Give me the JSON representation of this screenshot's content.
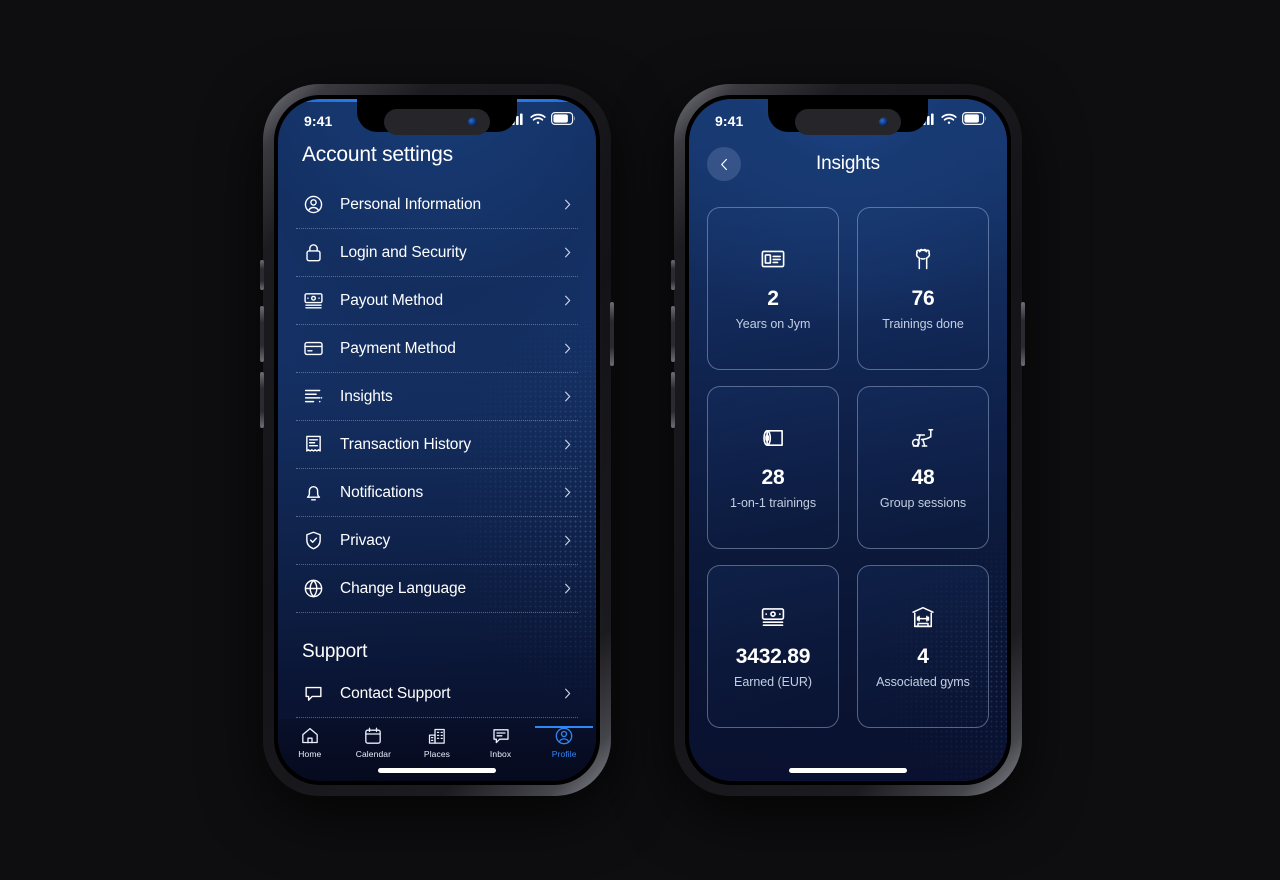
{
  "status_bar": {
    "time": "9:41",
    "signal_icon": "cellular-bars-icon",
    "wifi_icon": "wifi-icon",
    "battery_icon": "battery-icon"
  },
  "left_screen": {
    "title": "Account settings",
    "items": [
      {
        "label": "Personal Information",
        "icon": "user-circle-icon"
      },
      {
        "label": "Login and Security",
        "icon": "lock-icon"
      },
      {
        "label": "Payout Method",
        "icon": "banknote-icon"
      },
      {
        "label": "Payment Method",
        "icon": "credit-card-icon"
      },
      {
        "label": "Insights",
        "icon": "bar-chart-icon"
      },
      {
        "label": "Transaction History",
        "icon": "receipt-icon"
      },
      {
        "label": "Notifications",
        "icon": "bell-icon"
      },
      {
        "label": "Privacy",
        "icon": "shield-check-icon"
      },
      {
        "label": "Change Language",
        "icon": "globe-icon"
      }
    ],
    "support_section": {
      "title": "Support",
      "items": [
        {
          "label": "Contact Support",
          "icon": "chat-bubble-icon"
        }
      ]
    },
    "tab_bar": {
      "active": "Profile",
      "tabs": [
        {
          "label": "Home",
          "icon": "home-icon"
        },
        {
          "label": "Calendar",
          "icon": "calendar-icon"
        },
        {
          "label": "Places",
          "icon": "buildings-icon"
        },
        {
          "label": "Inbox",
          "icon": "chat-icon"
        },
        {
          "label": "Profile",
          "icon": "user-circle-icon"
        }
      ]
    },
    "accent_color": "#2f87f5"
  },
  "right_screen": {
    "nav_title": "Insights",
    "back_icon": "chevron-left-icon",
    "stats": [
      {
        "value": "2",
        "label": "Years on Jym",
        "icon": "id-card-icon"
      },
      {
        "value": "76",
        "label": "Trainings done",
        "icon": "flexed-arms-icon"
      },
      {
        "value": "28",
        "label": "1-on-1 trainings",
        "icon": "yoga-mat-icon"
      },
      {
        "value": "48",
        "label": "Group sessions",
        "icon": "exercise-bike-icon"
      },
      {
        "value": "3432.89",
        "label": "Earned (EUR)",
        "icon": "banknote-icon"
      },
      {
        "value": "4",
        "label": "Associated gyms",
        "icon": "gym-building-icon"
      }
    ]
  }
}
